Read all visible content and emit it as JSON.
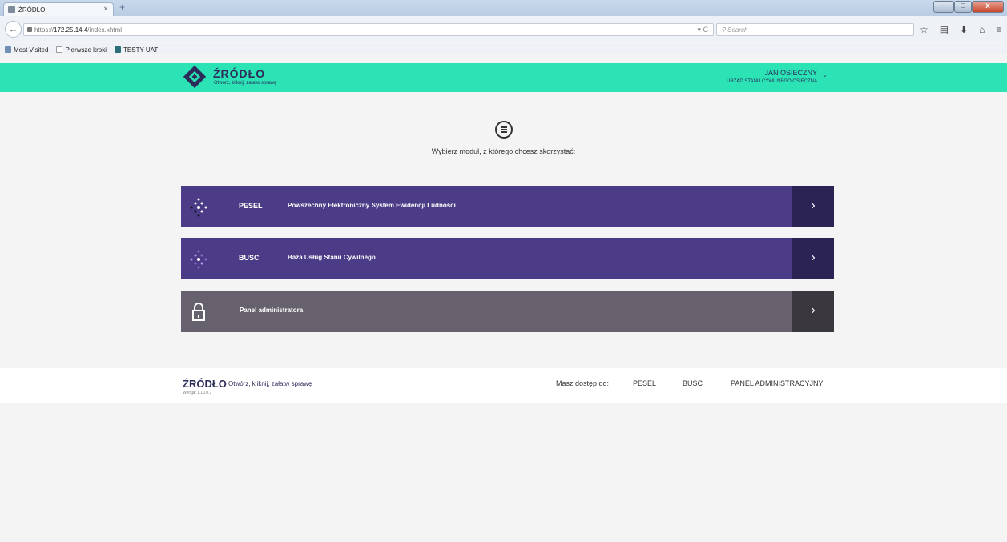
{
  "browser": {
    "tab_title": "ŹRÓDŁO",
    "tab_close": "×",
    "new_tab": "+",
    "window_min": "–",
    "window_max": "□",
    "window_close": "x",
    "url_scheme": "https://",
    "url_host": "172.25.14.4",
    "url_path": "/index.xhtml",
    "url_actions": "▾ C",
    "search_placeholder": "Search",
    "bookmarks": [
      "Most Visited",
      "Pierwsze kroki",
      "TESTY UAT"
    ]
  },
  "header": {
    "brand": "ŹRÓDŁO",
    "tagline": "Otwórz, kliknij, załatw sprawę",
    "user_name": "JAN OSIECZNY",
    "user_org": "URZĄD STANU CYWILNEGO OSIECZNA"
  },
  "main": {
    "prompt": "Wybierz moduł, z którego chcesz skorzystać:",
    "modules": [
      {
        "code": "PESEL",
        "description": "Powszechny Elektroniczny System Ewidencji Ludności",
        "arrow": "›"
      },
      {
        "code": "BUSC",
        "description": "Baza Usług Stanu Cywilnego",
        "arrow": "›"
      },
      {
        "code": "",
        "description": "Panel administratora",
        "arrow": "›"
      }
    ]
  },
  "footer": {
    "brand": "ŹRÓDŁO",
    "tagline": "Otwórz, kliknij, załatw sprawę",
    "version": "Wersja: 1.10.0.7",
    "access_label": "Masz dostęp do:",
    "links": [
      "PESEL",
      "BUSC",
      "PANEL ADMINISTRACYJNY"
    ]
  },
  "colors": {
    "header_bg": "#2be3b5",
    "module_primary": "#4c3b87",
    "module_primary_dark": "#2c2355",
    "module_admin": "#66616d",
    "module_admin_dark": "#3a373f"
  }
}
